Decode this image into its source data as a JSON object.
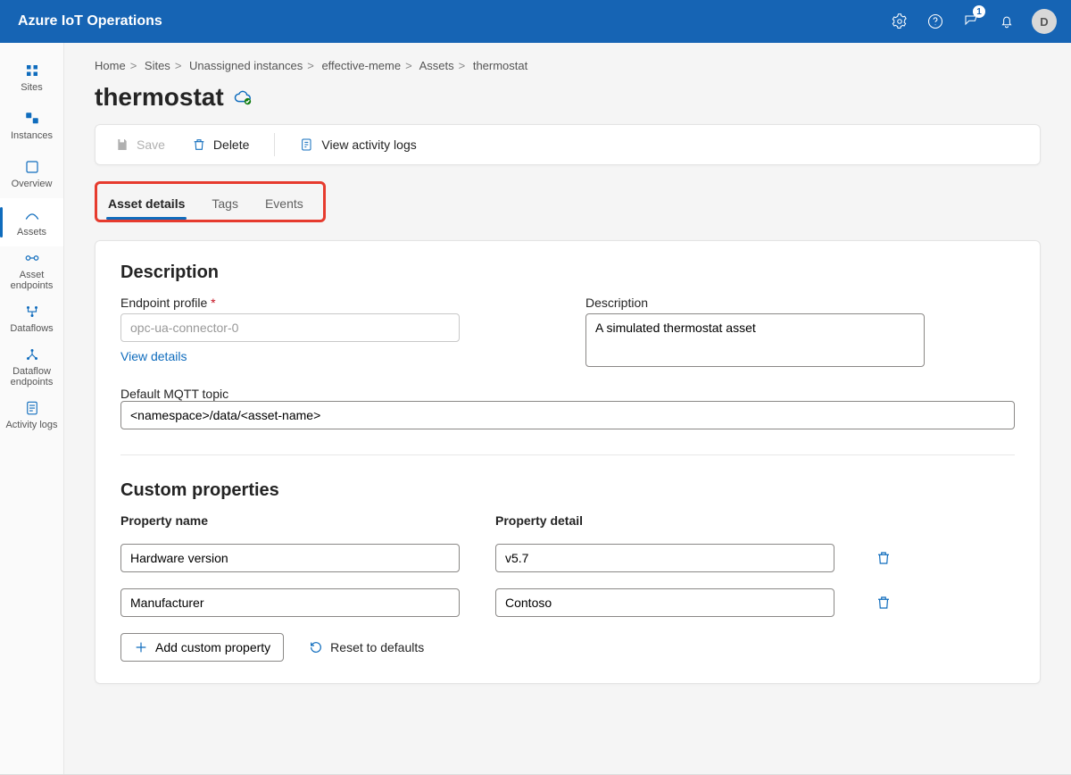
{
  "app": {
    "title": "Azure IoT Operations",
    "avatar_initial": "D",
    "notif_badge": "1"
  },
  "leftnav": {
    "items": [
      {
        "label": "Sites"
      },
      {
        "label": "Instances"
      },
      {
        "label": "Overview"
      },
      {
        "label": "Assets"
      },
      {
        "label": "Asset endpoints"
      },
      {
        "label": "Dataflows"
      },
      {
        "label": "Dataflow endpoints"
      },
      {
        "label": "Activity logs"
      }
    ]
  },
  "breadcrumbs": [
    "Home",
    "Sites",
    "Unassigned instances",
    "effective-meme",
    "Assets",
    "thermostat"
  ],
  "page": {
    "title": "thermostat"
  },
  "toolbar": {
    "save": "Save",
    "delete": "Delete",
    "activity_logs": "View activity logs"
  },
  "tabs": [
    "Asset details",
    "Tags",
    "Events"
  ],
  "details": {
    "section_title": "Description",
    "endpoint_profile_label": "Endpoint profile",
    "endpoint_profile_value": "opc-ua-connector-0",
    "view_details": "View details",
    "description_label": "Description",
    "description_value": "A simulated thermostat asset",
    "mqtt_label": "Default MQTT topic",
    "mqtt_value": "<namespace>/data/<asset-name>"
  },
  "custom_props": {
    "section_title": "Custom properties",
    "name_header": "Property name",
    "detail_header": "Property detail",
    "rows": [
      {
        "name": "Hardware version",
        "detail": "v5.7"
      },
      {
        "name": "Manufacturer",
        "detail": "Contoso"
      }
    ],
    "add_btn": "Add custom property",
    "reset_btn": "Reset to defaults"
  }
}
